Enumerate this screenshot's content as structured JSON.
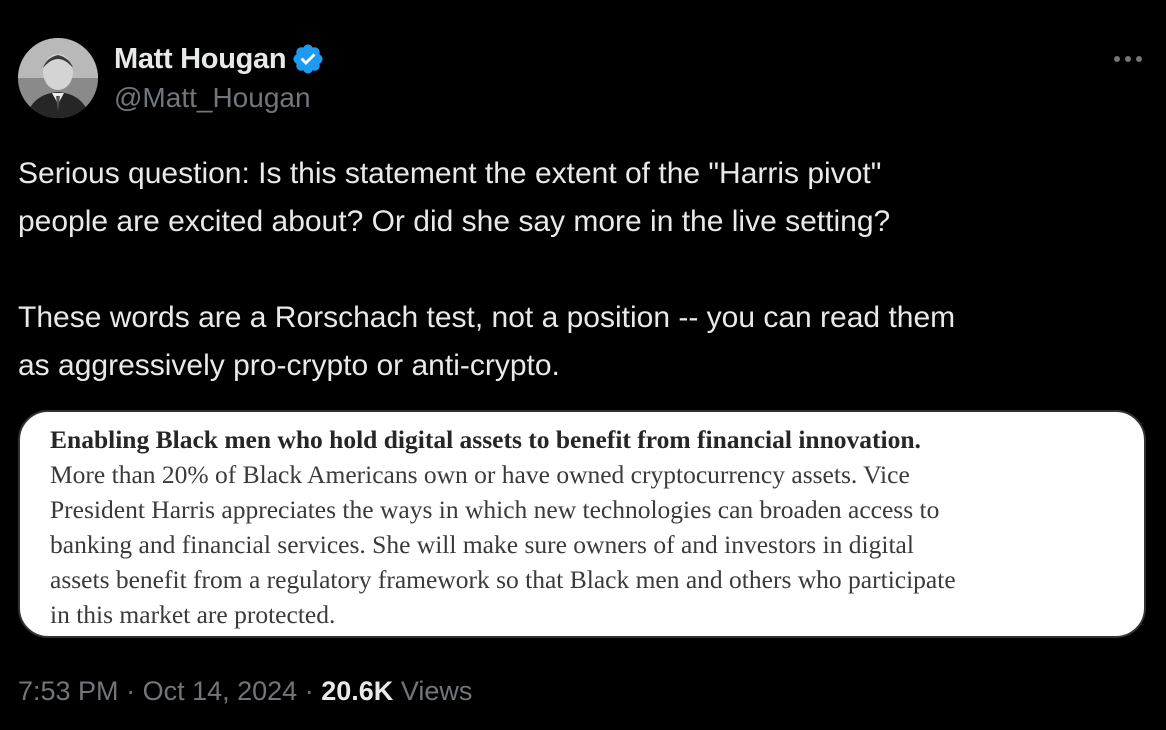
{
  "author": {
    "display_name": "Matt Hougan",
    "handle": "@Matt_Hougan",
    "verified": true,
    "avatar_icon": "profile-photo"
  },
  "tweet": {
    "paragraphs": [
      [
        "Serious question: Is this statement the extent of the \"Harris pivot\"",
        "people are excited about? Or did she say more in the live setting?"
      ],
      [
        "These words are a Rorschach test, not a position -- you can read them",
        "as aggressively pro-crypto or anti-crypto."
      ]
    ]
  },
  "media": {
    "heading": "Enabling Black men who hold digital assets to benefit from financial innovation.",
    "body_lines": [
      "More than 20% of Black Americans own or have owned cryptocurrency assets. Vice",
      "President Harris appreciates the ways in which new technologies can broaden access to",
      "banking and financial services. She will make sure owners of and investors in digital",
      "assets benefit from a regulatory framework so that Black men and others who participate",
      "in this market are protected."
    ]
  },
  "meta": {
    "time": "7:53 PM",
    "separator": "·",
    "date": "Oct 14, 2024",
    "views_count": "20.6K",
    "views_label": "Views"
  },
  "colors": {
    "background": "#000000",
    "primary_text": "#e7e9ea",
    "secondary_text": "#71767b",
    "verified_badge": "#1d9bf0",
    "border": "#2f3336"
  },
  "icons": {
    "more": "more-horizontal-icon",
    "verified": "verified-badge-icon"
  }
}
